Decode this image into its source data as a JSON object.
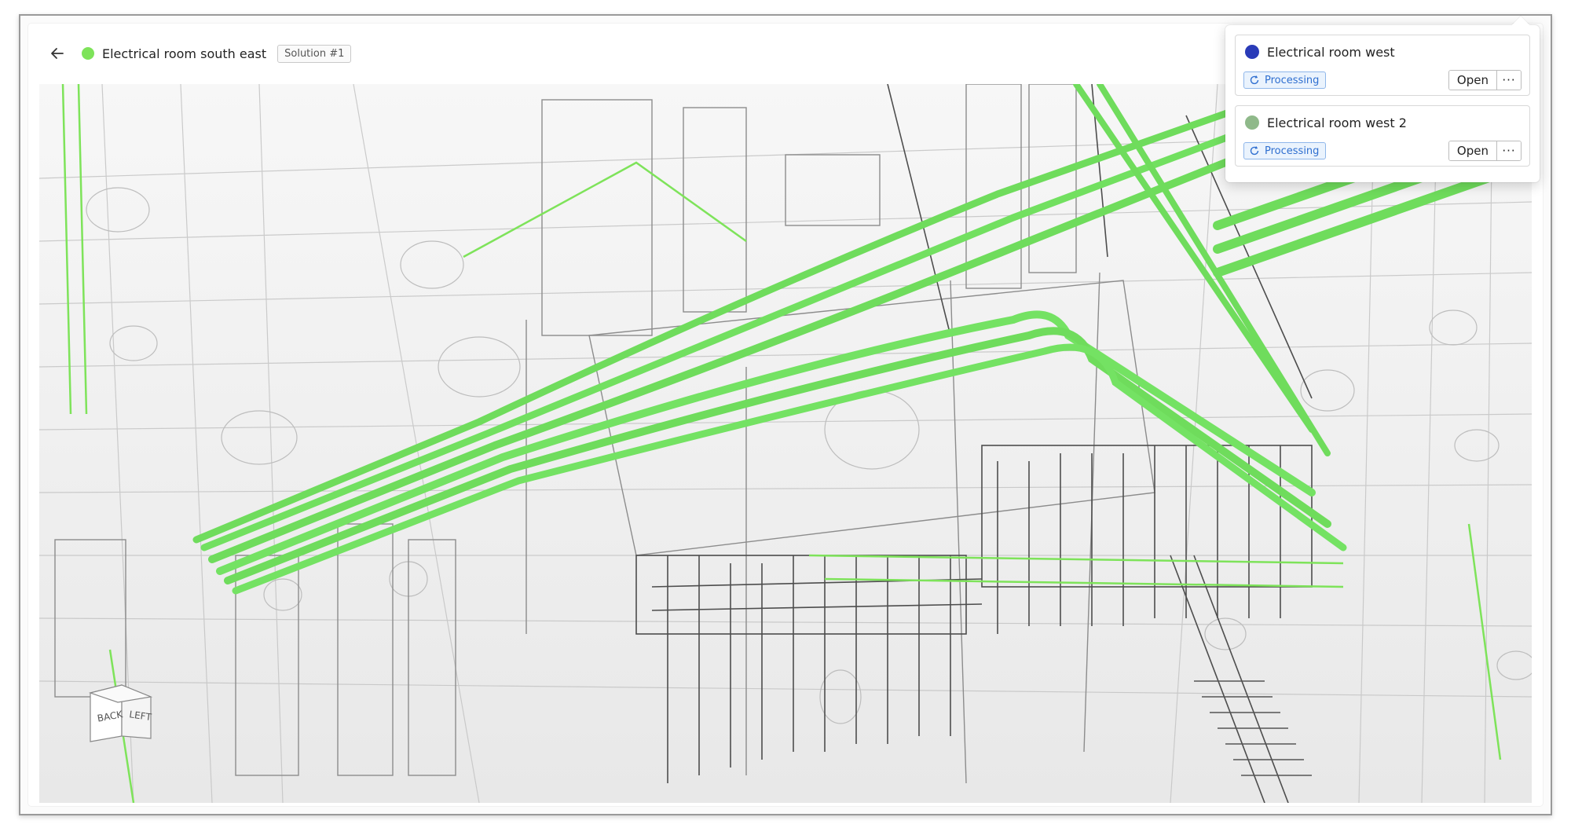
{
  "header": {
    "title": "Electrical room south east",
    "solution_tag": "Solution #1",
    "status_color": "#7ee35a"
  },
  "viewport": {
    "accent_color": "#6fdc5c",
    "nav_cube": {
      "face_back": "BACK",
      "face_left": "LEFT"
    }
  },
  "popover": {
    "items": [
      {
        "name": "Electrical room west",
        "color": "#2a3bb8",
        "status": "Processing",
        "open_label": "Open",
        "more_label": "···"
      },
      {
        "name": "Electrical room west 2",
        "color": "#8fb98a",
        "status": "Processing",
        "open_label": "Open",
        "more_label": "···"
      }
    ]
  },
  "icons": {
    "back": "arrow-left-icon",
    "status": "refresh-icon",
    "more": "ellipsis-icon"
  }
}
